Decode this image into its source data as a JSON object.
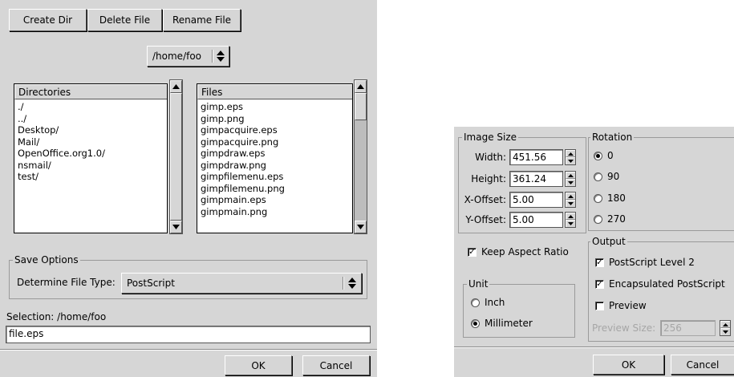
{
  "file_dialog": {
    "toolbar": {
      "create_dir": "Create Dir",
      "delete_file": "Delete File",
      "rename_file": "Rename File"
    },
    "path_menu": {
      "value": "/home/foo",
      "icon": "updown-arrows-icon"
    },
    "directories": {
      "header": "Directories",
      "items": [
        "./",
        "../",
        "Desktop/",
        "Mail/",
        "OpenOffice.org1.0/",
        "nsmail/",
        "test/"
      ]
    },
    "files": {
      "header": "Files",
      "items": [
        "gimp.eps",
        "gimp.png",
        "gimpacquire.eps",
        "gimpacquire.png",
        "gimpdraw.eps",
        "gimpdraw.png",
        "gimpfilemenu.eps",
        "gimpfilemenu.png",
        "gimpmain.eps",
        "gimpmain.png"
      ]
    },
    "save_options": {
      "frame_label": "Save Options",
      "file_type_label": "Determine File Type:",
      "file_type_value": "PostScript"
    },
    "selection": {
      "label": "Selection: /home/foo",
      "value": "file.eps"
    },
    "buttons": {
      "ok": "OK",
      "cancel": "Cancel"
    }
  },
  "ps_dialog": {
    "image_size": {
      "frame_label": "Image Size",
      "width_label": "Width:",
      "width_value": "451.56",
      "height_label": "Height:",
      "height_value": "361.24",
      "xoffset_label": "X-Offset:",
      "xoffset_value": "5.00",
      "yoffset_label": "Y-Offset:",
      "yoffset_value": "5.00"
    },
    "keep_aspect": {
      "label": "Keep Aspect Ratio",
      "checked": true
    },
    "unit": {
      "frame_label": "Unit",
      "options": [
        "Inch",
        "Millimeter"
      ],
      "selected": "Millimeter"
    },
    "rotation": {
      "frame_label": "Rotation",
      "options": [
        "0",
        "90",
        "180",
        "270"
      ],
      "selected": "0"
    },
    "output": {
      "frame_label": "Output",
      "postscript_level2": {
        "label": "PostScript Level 2",
        "checked": true
      },
      "encapsulated": {
        "label": "Encapsulated PostScript",
        "checked": true
      },
      "preview": {
        "label": "Preview",
        "checked": false
      },
      "preview_size_label": "Preview Size:",
      "preview_size_value": "256"
    },
    "buttons": {
      "ok": "OK",
      "cancel": "Cancel"
    }
  }
}
